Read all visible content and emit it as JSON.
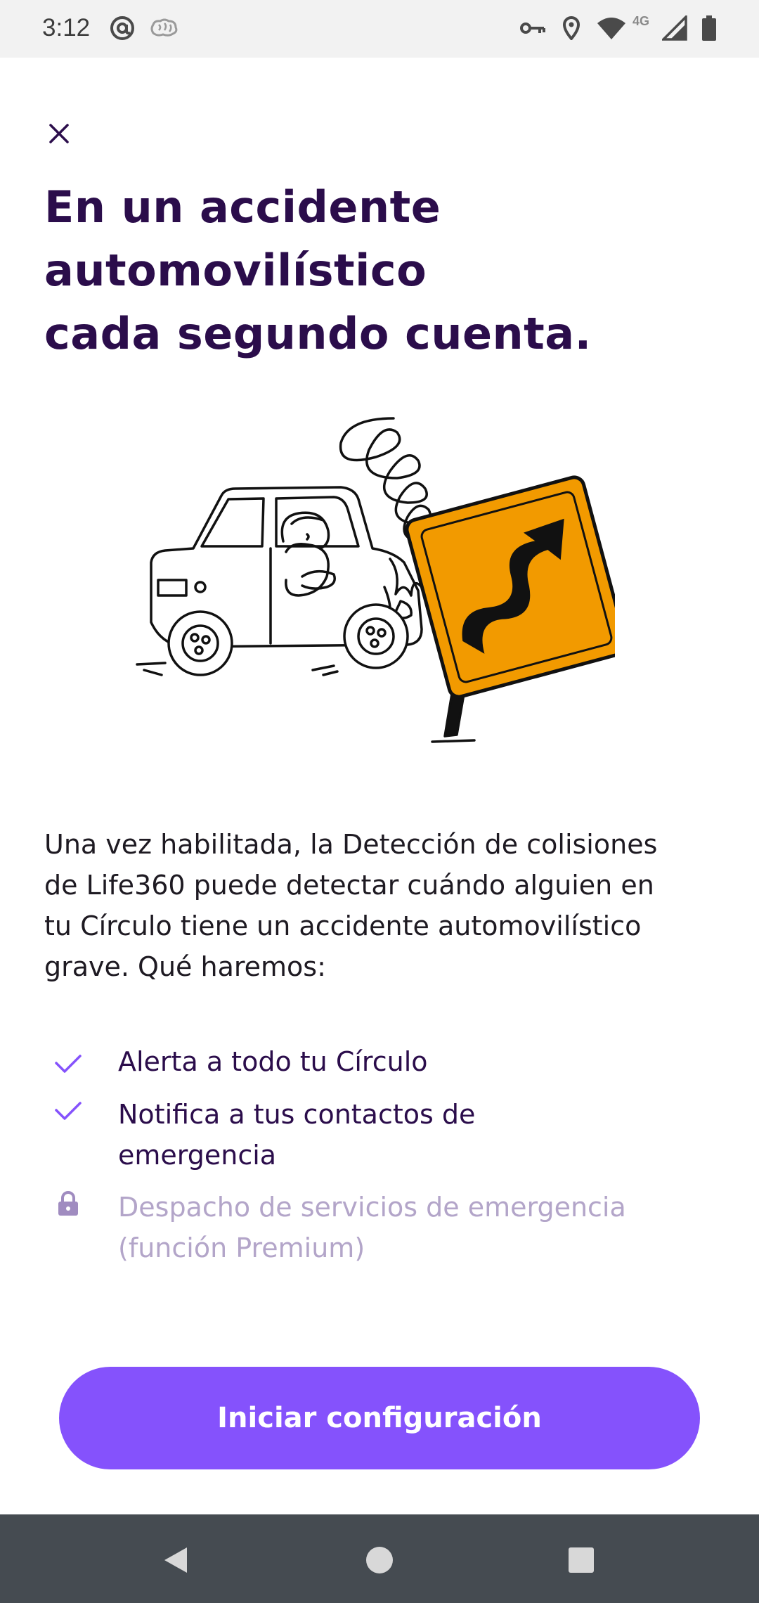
{
  "status_bar": {
    "time": "3:12",
    "network_label": "4G",
    "icons": [
      "at-sign-icon",
      "brain-icon",
      "vpn-key-icon",
      "location-icon",
      "wifi-icon",
      "signal-icon",
      "battery-icon"
    ]
  },
  "screen": {
    "close_icon": "close-icon",
    "title_lines": [
      "En un accidente",
      "automovilístico",
      "cada segundo cuenta."
    ],
    "body_lines": [
      "Una vez habilitada, la Detección de colisiones",
      "de Life360 puede detectar cuándo alguien en",
      "tu Círculo tiene un accidente automovilístico",
      "grave. Qué haremos:"
    ],
    "features": [
      {
        "icon": "check-icon",
        "lines": [
          "Alerta a todo tu Círculo"
        ],
        "locked": false
      },
      {
        "icon": "check-icon",
        "lines": [
          "Notifica a tus contactos de",
          "emergencia"
        ],
        "locked": false
      },
      {
        "icon": "lock-icon",
        "lines": [
          "Despacho de servicios de emergencia",
          "(función Premium)"
        ],
        "locked": true
      }
    ],
    "cta_label": "Iniciar configuración"
  },
  "colors": {
    "title": "#2b0d4b",
    "accent": "#8552fc",
    "check": "#8552fc",
    "locked_text": "#b3a5c9",
    "sign": "#f29a00",
    "nav_bar": "#454b51"
  },
  "nav_bar": {
    "icons": [
      "back-icon",
      "home-icon",
      "recents-icon"
    ]
  }
}
